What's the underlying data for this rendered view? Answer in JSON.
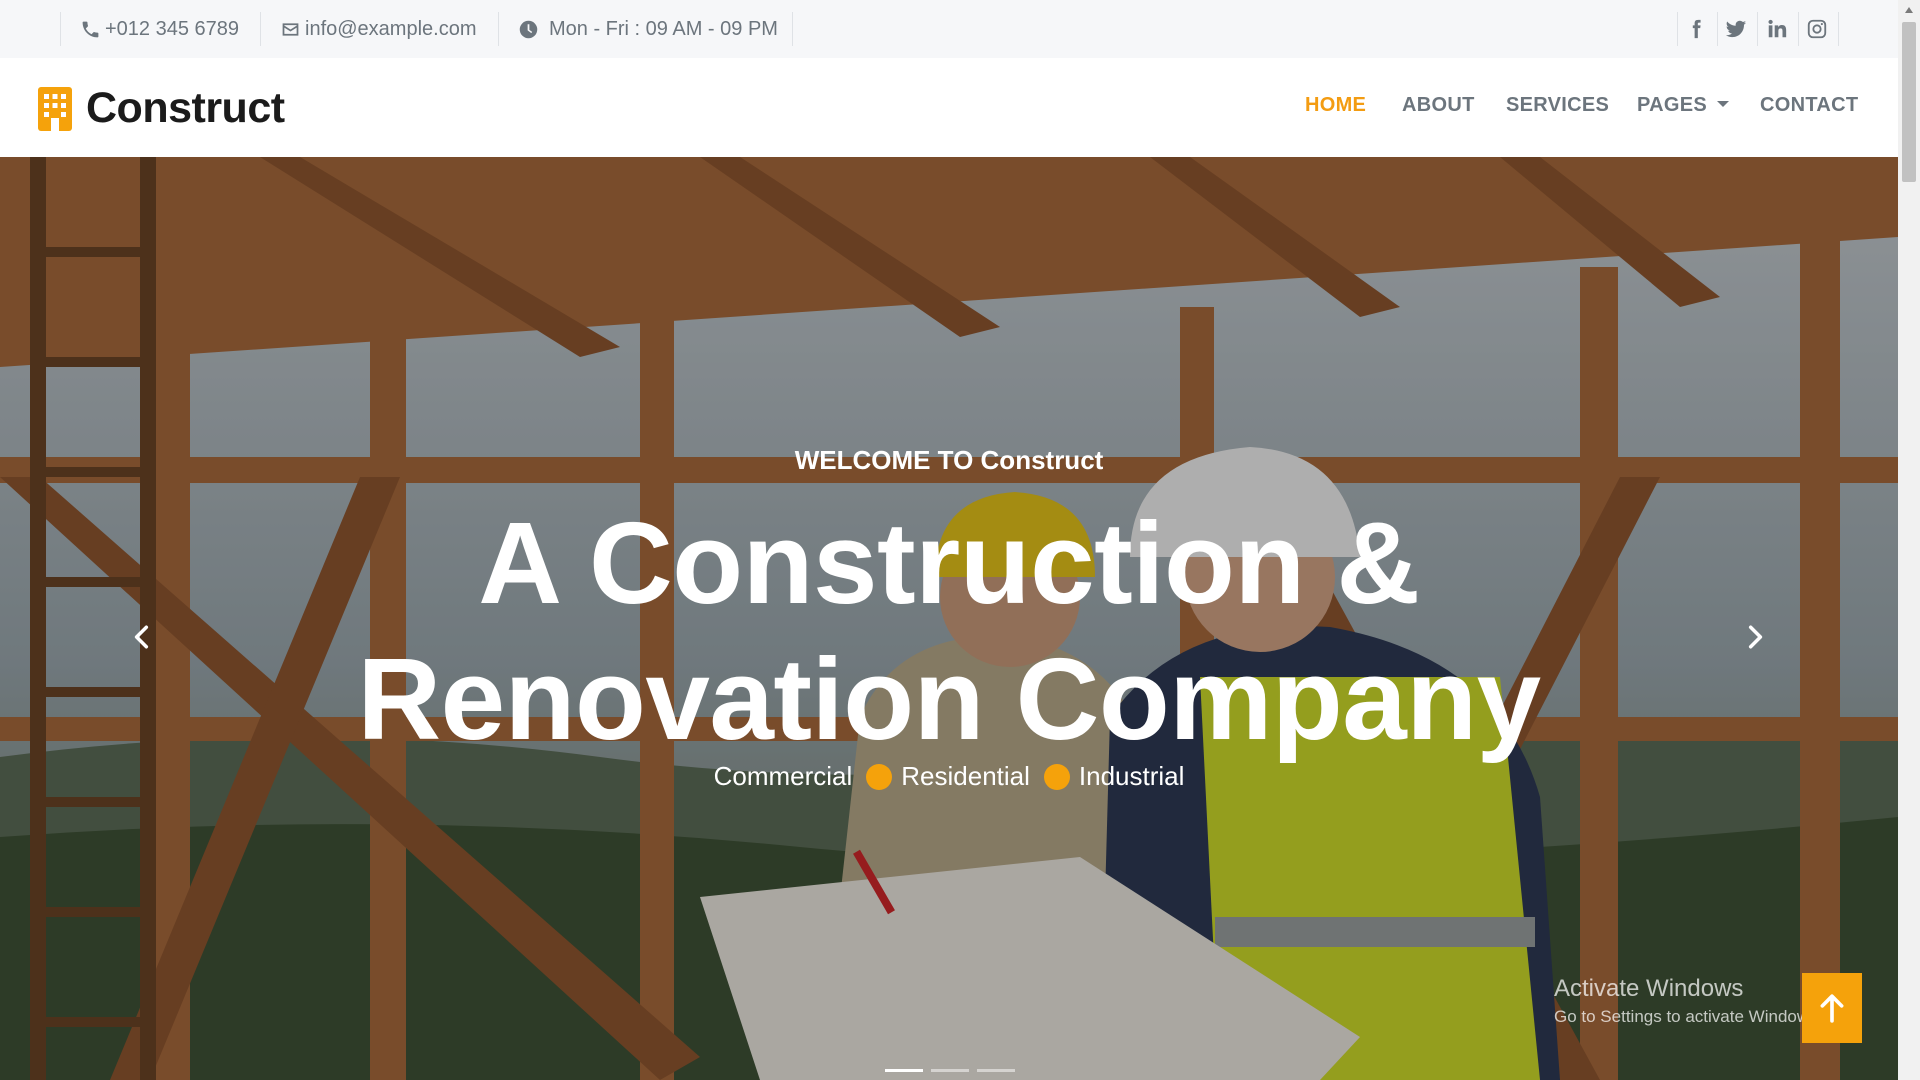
{
  "topbar": {
    "phone": "+012 345 6789",
    "email": "info@example.com",
    "hours": "Mon - Fri : 09 AM - 09 PM",
    "icons": {
      "phone": "phone-icon",
      "email": "envelope-icon",
      "hours": "clock-icon"
    },
    "social": [
      "facebook-icon",
      "twitter-icon",
      "linkedin-icon",
      "instagram-icon"
    ]
  },
  "brand": {
    "name": "Construct",
    "icon": "building-icon",
    "accent": "#f39c12"
  },
  "nav": {
    "home": "HOME",
    "about": "ABOUT",
    "services": "SERVICES",
    "pages": "PAGES",
    "contact": "CONTACT",
    "active": "HOME"
  },
  "hero": {
    "welcome": "WELCOME TO Construct",
    "headline": "A Construction & Renovation Company",
    "tags": [
      "Commercial",
      "Residential",
      "Industrial"
    ],
    "prev_icon": "chevron-left-icon",
    "next_icon": "chevron-right-icon",
    "slide_count": 3,
    "active_slide": 1
  },
  "watermark": {
    "title": "Activate Windows",
    "subtitle": "Go to Settings to activate Windows."
  },
  "back_to_top_icon": "arrow-up-icon",
  "colors": {
    "accent": "#f5a20b",
    "nav_text": "#6c757d",
    "topbar_bg": "#f6f7f9"
  }
}
